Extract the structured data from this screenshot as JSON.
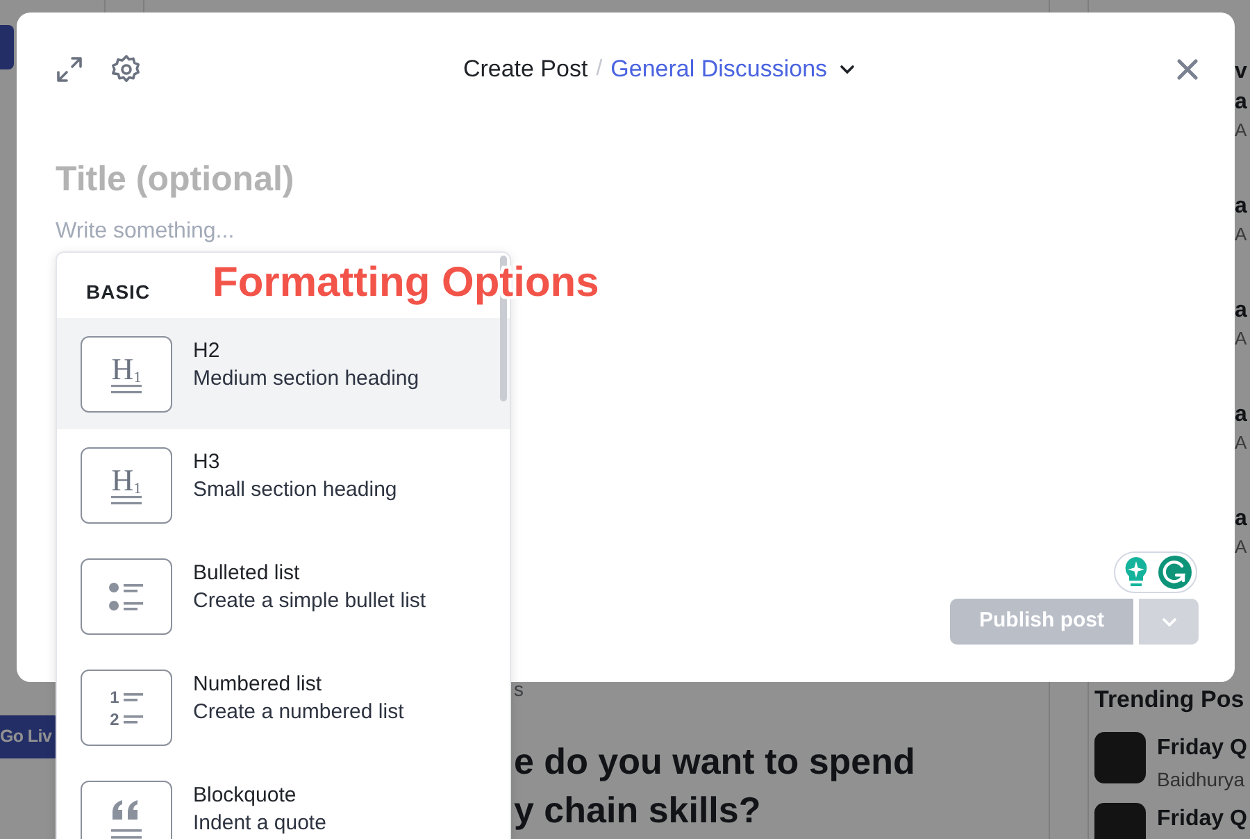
{
  "background": {
    "go_live_button": "Go Liv",
    "feed_label": "s",
    "post_title": [
      "e do you want to spend",
      "y chain skills?"
    ],
    "side_fragments": [
      {
        "title": "v"
      },
      {
        "title": "a",
        "meta": "A"
      },
      {
        "title": "a",
        "meta": "A"
      },
      {
        "title": "a",
        "meta": "A"
      },
      {
        "title": "a",
        "meta": "A"
      },
      {
        "title": "a",
        "meta": "A"
      }
    ],
    "trending": {
      "heading": "Trending Pos",
      "posts": [
        {
          "title": "Friday Q",
          "author": "Baidhurya"
        },
        {
          "title": "Friday Q"
        }
      ]
    }
  },
  "modal": {
    "title": "Create Post",
    "separator": "/",
    "category": "General Discussions",
    "title_field": {
      "placeholder": "Title (optional)"
    },
    "body_field": {
      "placeholder": "Write something..."
    },
    "publish_button": {
      "label": "Publish post",
      "disabled": true
    }
  },
  "menu": {
    "section": "BASIC",
    "items": [
      {
        "kind": "heading",
        "icon_text": "H$_{1}$",
        "label": "H2",
        "description": "Medium section heading",
        "selected": true
      },
      {
        "kind": "heading",
        "icon_text": "H$_{1}$",
        "label": "H3",
        "description": "Small section heading",
        "selected": false
      },
      {
        "kind": "bullets",
        "label": "Bulleted list",
        "description": "Create a simple bullet list",
        "selected": false
      },
      {
        "kind": "numbers",
        "icon_digits": [
          "1",
          "2"
        ],
        "label": "Numbered list",
        "description": "Create a numbered list",
        "selected": false
      },
      {
        "kind": "quote",
        "label": "Blockquote",
        "description": "Indent a quote",
        "selected": false
      }
    ]
  },
  "annotation": "Formatting Options"
}
